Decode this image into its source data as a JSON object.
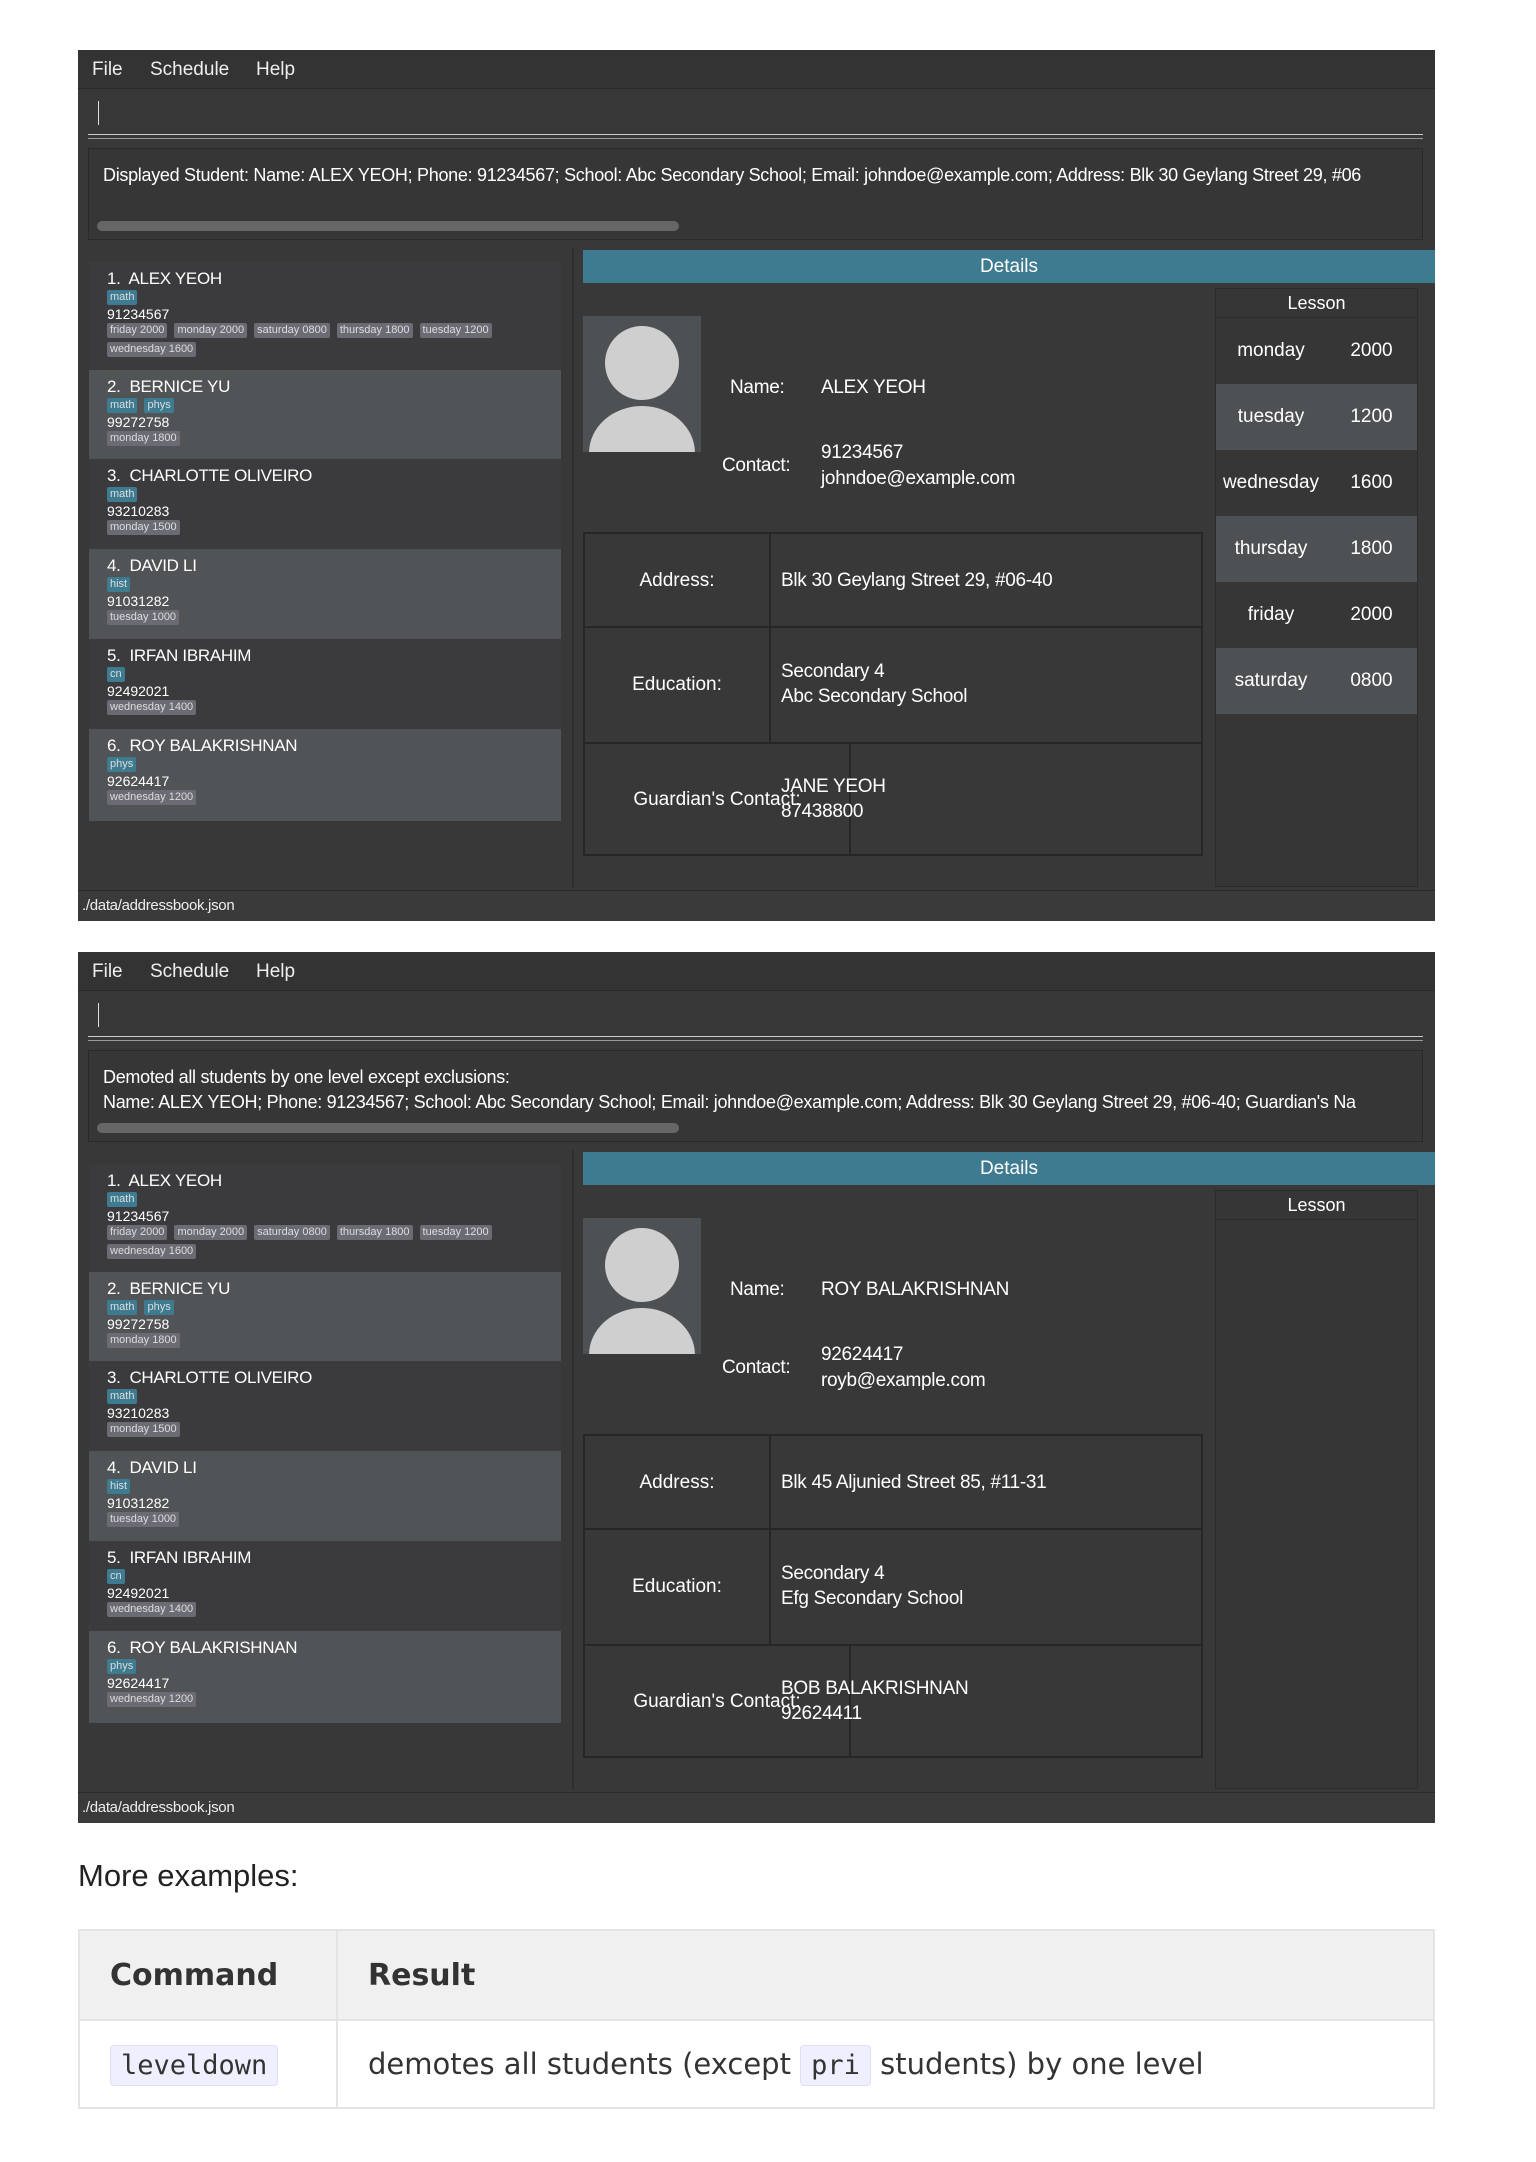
{
  "windows": [
    {
      "menu": [
        "File",
        "Schedule",
        "Help"
      ],
      "command_input": "",
      "result_text": "Displayed Student: Name: ALEX YEOH; Phone: 91234567; School: Abc Secondary School; Email: johndoe@example.com; Address: Blk 30 Geylang Street 29, #06",
      "details_header": "Details",
      "detail": {
        "name_label": "Name:",
        "name": "ALEX YEOH",
        "contact_label": "Contact:",
        "phone": "91234567",
        "email": "johndoe@example.com",
        "address_label": "Address:",
        "address": "Blk 30 Geylang Street 29, #06-40",
        "education_label": "Education:",
        "level": "Secondary 4",
        "school": "Abc Secondary School",
        "guardian_label": "Guardian's Contact:",
        "guardian_name": "JANE YEOH",
        "guardian_phone": "87438800"
      },
      "lesson_header": "Lesson",
      "lessons": [
        {
          "day": "monday",
          "time": "2000"
        },
        {
          "day": "tuesday",
          "time": "1200"
        },
        {
          "day": "wednesday",
          "time": "1600"
        },
        {
          "day": "thursday",
          "time": "1800"
        },
        {
          "day": "friday",
          "time": "2000"
        },
        {
          "day": "saturday",
          "time": "0800"
        }
      ],
      "status": "./data/addressbook.json"
    },
    {
      "menu": [
        "File",
        "Schedule",
        "Help"
      ],
      "command_input": "",
      "result_text": "Demoted all students by one level except exclusions:\nName: ALEX YEOH; Phone: 91234567; School: Abc Secondary School; Email: johndoe@example.com; Address: Blk 30 Geylang Street 29, #06-40; Guardian's Na",
      "details_header": "Details",
      "detail": {
        "name_label": "Name:",
        "name": "ROY BALAKRISHNAN",
        "contact_label": "Contact:",
        "phone": "92624417",
        "email": "royb@example.com",
        "address_label": "Address:",
        "address": "Blk 45 Aljunied Street 85, #11-31",
        "education_label": "Education:",
        "level": "Secondary 4",
        "school": "Efg Secondary School",
        "guardian_label": "Guardian's Contact:",
        "guardian_name": "BOB BALAKRISHNAN",
        "guardian_phone": "92624411"
      },
      "lesson_header": "Lesson",
      "lessons": [],
      "status": "./data/addressbook.json"
    }
  ],
  "students": [
    {
      "index": "1.",
      "name": "ALEX YEOH",
      "subjects": [
        "math"
      ],
      "phone": "91234567",
      "lessons": [
        "friday 2000",
        "monday 2000",
        "saturday 0800",
        "thursday 1800",
        "tuesday 1200",
        "wednesday 1600"
      ]
    },
    {
      "index": "2.",
      "name": "BERNICE YU",
      "subjects": [
        "math",
        "phys"
      ],
      "phone": "99272758",
      "lessons": [
        "monday 1800"
      ]
    },
    {
      "index": "3.",
      "name": "CHARLOTTE OLIVEIRO",
      "subjects": [
        "math"
      ],
      "phone": "93210283",
      "lessons": [
        "monday 1500"
      ]
    },
    {
      "index": "4.",
      "name": "DAVID LI",
      "subjects": [
        "hist"
      ],
      "phone": "91031282",
      "lessons": [
        "tuesday 1000"
      ]
    },
    {
      "index": "5.",
      "name": "IRFAN IBRAHIM",
      "subjects": [
        "cn"
      ],
      "phone": "92492021",
      "lessons": [
        "wednesday 1400"
      ]
    },
    {
      "index": "6.",
      "name": "ROY BALAKRISHNAN",
      "subjects": [
        "phys"
      ],
      "phone": "92624417",
      "lessons": [
        "wednesday 1200"
      ]
    }
  ],
  "doc": {
    "heading": "More examples:",
    "table_headers": [
      "Command",
      "Result"
    ],
    "rows": [
      {
        "command": "leveldown",
        "result_before": "demotes all students (except ",
        "result_code": "pri",
        "result_after": " students) by one level"
      }
    ]
  }
}
